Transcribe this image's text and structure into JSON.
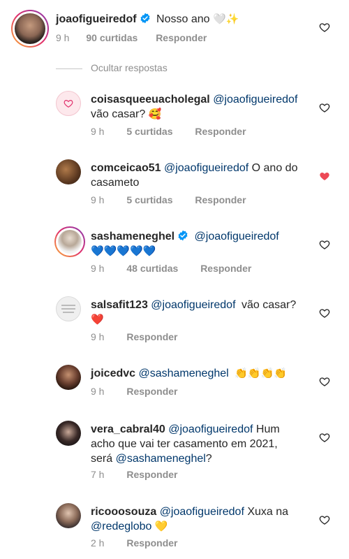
{
  "main_comment": {
    "username": "joaofigueiredof",
    "text": "Nosso ano",
    "emojis": "🤍✨",
    "time": "9 h",
    "likes": "90 curtidas",
    "reply": "Responder"
  },
  "hide_replies": "Ocultar respostas",
  "replies": [
    {
      "username": "coisasqueeuacholegal",
      "mention": "@joaofigueiredof",
      "text": "vão casar?",
      "emoji": "🥰",
      "time": "9 h",
      "likes": "5 curtidas",
      "reply": "Responder",
      "liked": false
    },
    {
      "username": "comceicao51",
      "mention": "@joaofigueiredof",
      "text": "O ano do casameto",
      "time": "9 h",
      "likes": "5 curtidas",
      "reply": "Responder",
      "liked": true
    },
    {
      "username": "sashameneghel",
      "mention": "@joaofigueiredof",
      "emoji_line": "💙💙💙💙💙",
      "time": "9 h",
      "likes": "48 curtidas",
      "reply": "Responder",
      "liked": false
    },
    {
      "username": "salsafit123",
      "mention": "@joaofigueiredof",
      "text": "vão casar?",
      "emoji": "❤️",
      "time": "9 h",
      "reply": "Responder",
      "liked": false
    },
    {
      "username": "joicedvc",
      "mention": "@sashameneghel",
      "emoji": "👏👏👏👏",
      "time": "9 h",
      "reply": "Responder",
      "liked": false
    },
    {
      "username": "vera_cabral40",
      "mention": "@joaofigueiredof",
      "text_a": "Hum",
      "text_b": "acho que vai ter casamento em 2021,",
      "text_c": "será",
      "mention2": "@sashameneghel",
      "text_d": "?",
      "time": "7 h",
      "reply": "Responder",
      "liked": false
    },
    {
      "username": "ricooosouza",
      "mention": "@joaofigueiredof",
      "text": "Xuxa na",
      "mention2": "@redeglobo",
      "emoji": "💛",
      "time": "2 h",
      "reply": "Responder",
      "liked": false
    }
  ],
  "colors": {
    "accent_blue": "#0095f6",
    "like_red": "#ed4956",
    "muted": "#8e8e8e"
  },
  "icons": [
    "verified-badge-icon",
    "heart-outline-icon",
    "heart-filled-icon"
  ]
}
